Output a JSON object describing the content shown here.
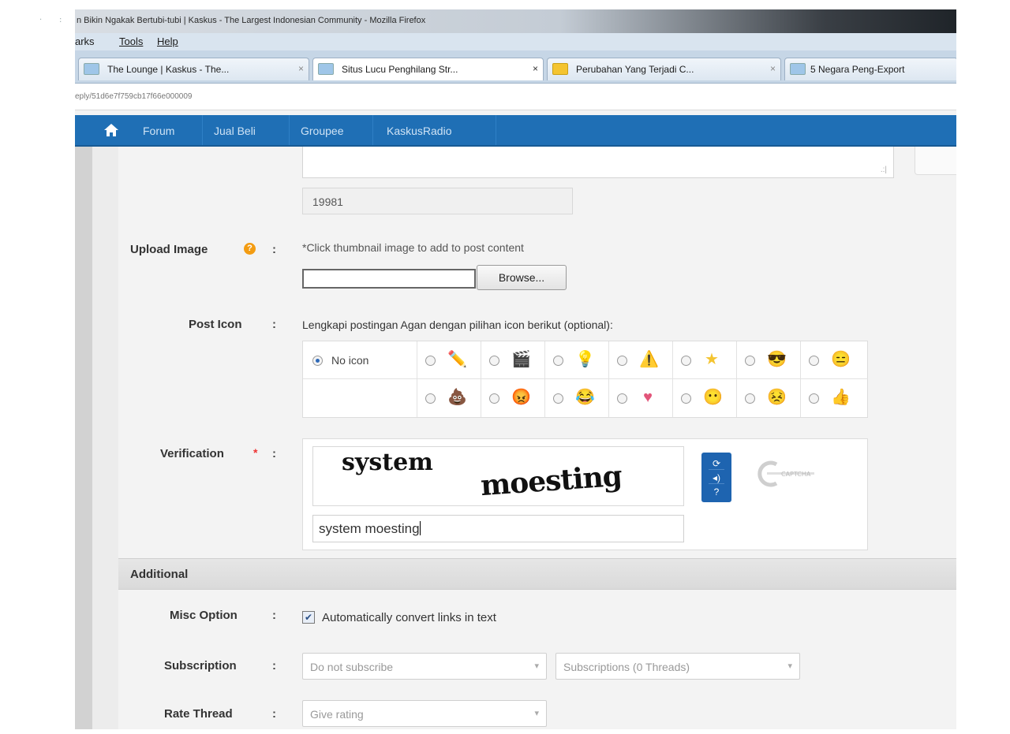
{
  "window": {
    "title": "n Bikin Ngakak Bertubi-tubi | Kaskus - The Largest Indonesian Community - Mozilla Firefox"
  },
  "menu": [
    "arks",
    "Tools",
    "Help"
  ],
  "tabs": [
    {
      "label": "The Lounge | Kaskus - The...",
      "favicon": "kaskus-favicon"
    },
    {
      "label": "Situs Lucu Penghilang Str...",
      "favicon": "kaskus-favicon",
      "active": true
    },
    {
      "label": "Perubahan Yang Terjadi C...",
      "favicon": "yellow-favicon"
    },
    {
      "label": "5 Negara Peng-Export",
      "favicon": "kaskus-favicon"
    }
  ],
  "address": {
    "url": "eply/51d6e7f759cb17f66e000009"
  },
  "sitenav": {
    "home_icon": "home-icon",
    "items": [
      "Forum",
      "Jual Beli",
      "Groupee",
      "KaskusRadio"
    ]
  },
  "form": {
    "char_count": "19981",
    "upload": {
      "label": "Upload Image",
      "hint": "*Click thumbnail image to add to post content",
      "browse_label": "Browse..."
    },
    "post_icon": {
      "label": "Post Icon",
      "description": "Lengkapi postingan Agan dengan pilihan icon berikut (optional):",
      "no_icon_label": "No icon",
      "row1": [
        "pencil-icon",
        "clapperboard-icon",
        "lightbulb-icon",
        "warning-icon",
        "star-icon",
        "cool-face-icon",
        "wink-face-icon"
      ],
      "row2": [
        "poop-icon",
        "angry-face-icon",
        "laugh-face-icon",
        "heart-icon",
        "blue-face-icon",
        "red-face-icon",
        "thumbs-face-icon"
      ]
    },
    "verification": {
      "label": "Verification",
      "required_mark": "*",
      "captcha_word1": "system",
      "captcha_word2": "moesting",
      "input_value": "system moesting",
      "captcha_brand": "CAPTCHA"
    },
    "additional_header": "Additional",
    "misc": {
      "label": "Misc Option",
      "checkbox_label": "Automatically convert links in text",
      "checked": true
    },
    "subscription": {
      "label": "Subscription",
      "select1": "Do not subscribe",
      "select2": "Subscriptions (0 Threads)"
    },
    "rate": {
      "label": "Rate Thread",
      "select": "Give rating"
    }
  },
  "colors": {
    "nav_blue": "#1f6fb5",
    "required_red": "#e33",
    "info_orange": "#f39c12"
  }
}
